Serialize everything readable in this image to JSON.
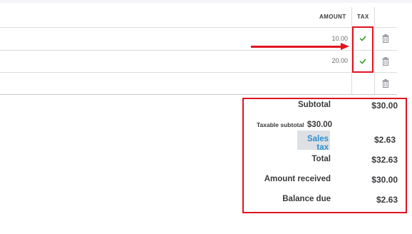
{
  "table": {
    "headers": {
      "amount": "AMOUNT",
      "tax": "TAX"
    },
    "rows": [
      {
        "amount": "10.00",
        "taxable": true
      },
      {
        "amount": "20.00",
        "taxable": true
      },
      {
        "amount": "",
        "taxable": false
      }
    ]
  },
  "totals": {
    "subtotal_label": "Subtotal",
    "subtotal_value": "$30.00",
    "taxable_subtotal_label": "Taxable subtotal",
    "taxable_subtotal_value": "$30.00",
    "sales_tax_label": "Sales tax",
    "sales_tax_value": "$2.63",
    "total_label": "Total",
    "total_value": "$32.63",
    "amount_received_label": "Amount received",
    "amount_received_value": "$30.00",
    "balance_due_label": "Balance due",
    "balance_due_value": "$2.63"
  },
  "colors": {
    "annotation": "#e0141e",
    "checkmark": "#2ca01c",
    "link": "#2d8fd0"
  },
  "icons": {
    "tax_check": "checkmark-icon",
    "delete": "trash-icon"
  }
}
